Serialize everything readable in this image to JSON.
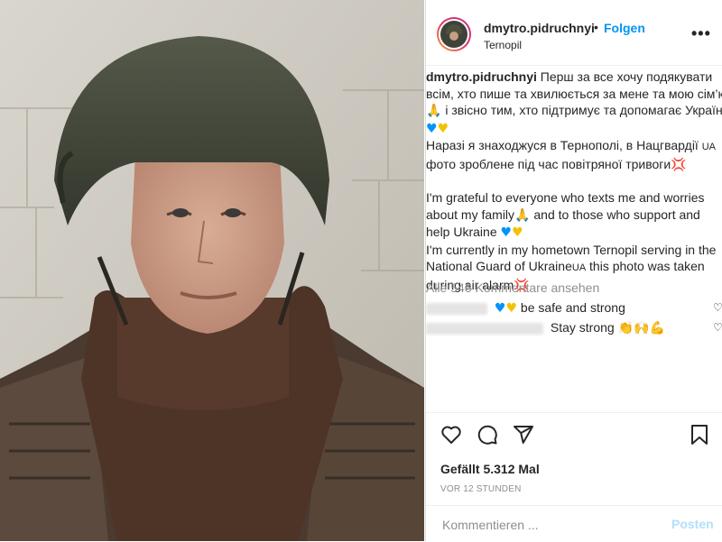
{
  "post": {
    "username": "dmytro.pidruchnyi",
    "separator": "•",
    "follow_label": "Folgen",
    "location": "Ternopil",
    "more_label": "•••"
  },
  "caption": {
    "lines": [
      "Перш за все хочу подякувати",
      "всім, хто пише та хвилюється за мене та мою сім’ю",
      "і звісно тим, хто підтримує та допомагає Україні",
      "Наразі я знаходжуся в Тернополі, в Нацгвардії",
      "фото зроблене під час повітряної тривоги",
      "I'm grateful to everyone who texts me and worries",
      "about my family",
      "and to those who support and",
      "help Ukraine",
      "I'm currently in my hometown Ternopil serving in the",
      "National Guard of Ukraine",
      "this photo was taken",
      "during air alarm"
    ],
    "ua_flag_text": "UA"
  },
  "comments": {
    "view_all": "Alle 546 Kommentare ansehen",
    "items": [
      {
        "text": "be safe and strong"
      },
      {
        "text": "Stay strong"
      }
    ]
  },
  "actions": {
    "likes": "Gefällt 5.312 Mal",
    "time": "VOR 12 STUNDEN"
  },
  "add_comment": {
    "placeholder": "Kommentieren ...",
    "post_label": "Posten"
  }
}
